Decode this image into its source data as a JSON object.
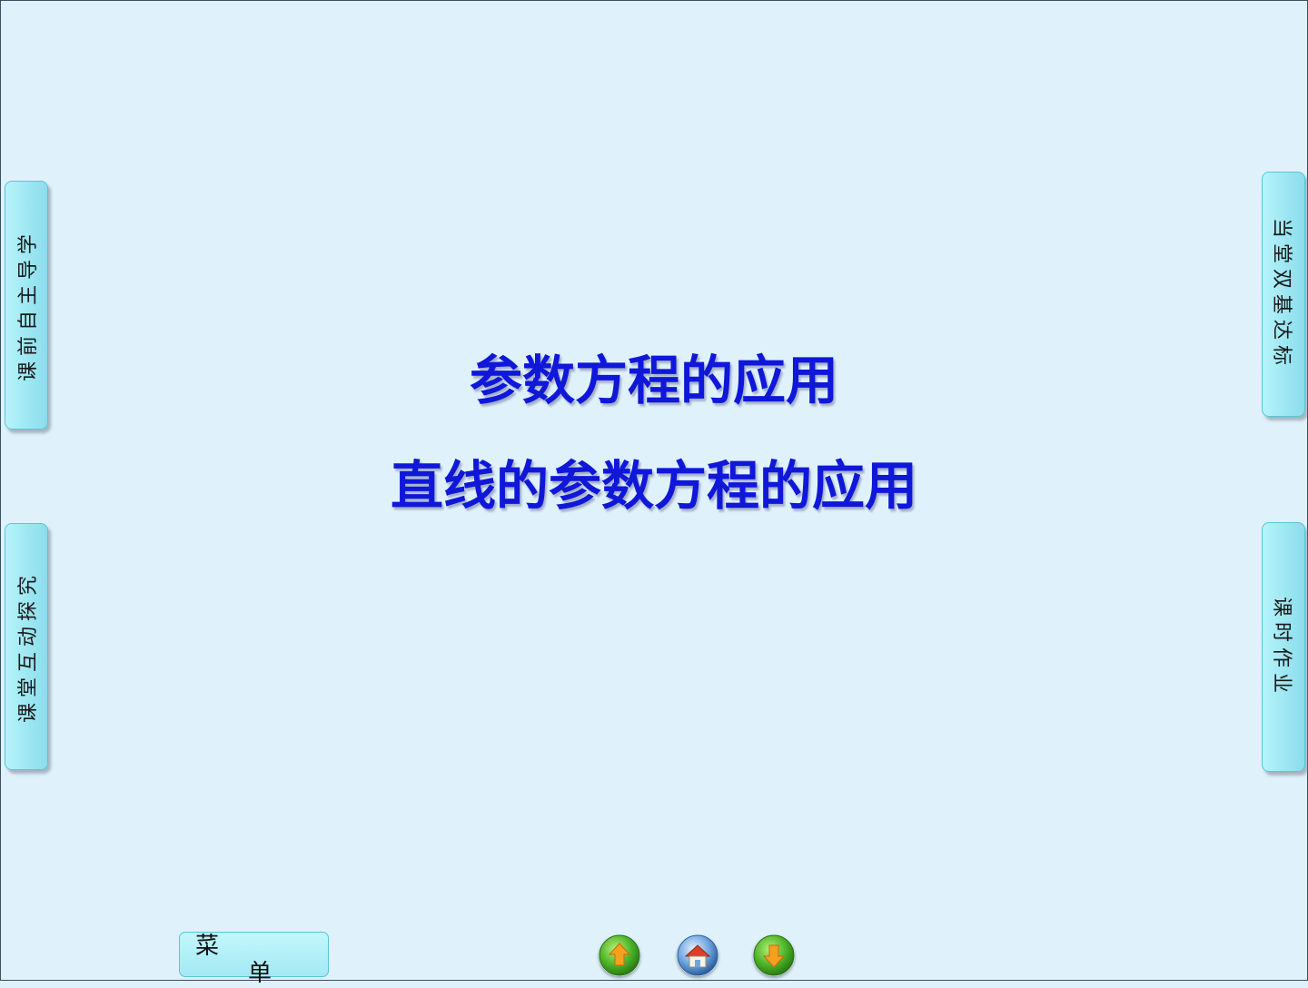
{
  "side_tabs": {
    "left_top": "课前自主导学",
    "left_bottom": "课堂互动探究",
    "right_top": "当堂双基达标",
    "right_bottom": "课时作业"
  },
  "titles": {
    "main": "参数方程的应用",
    "sub": "直线的参数方程的应用"
  },
  "menu": {
    "char1": "菜",
    "char2": "单"
  },
  "nav": {
    "icons": [
      "up-arrow-icon",
      "home-icon",
      "down-arrow-icon"
    ]
  },
  "colors": {
    "background": "#dff2fc",
    "title": "#0f17d8",
    "tab": "#9de7f3"
  }
}
